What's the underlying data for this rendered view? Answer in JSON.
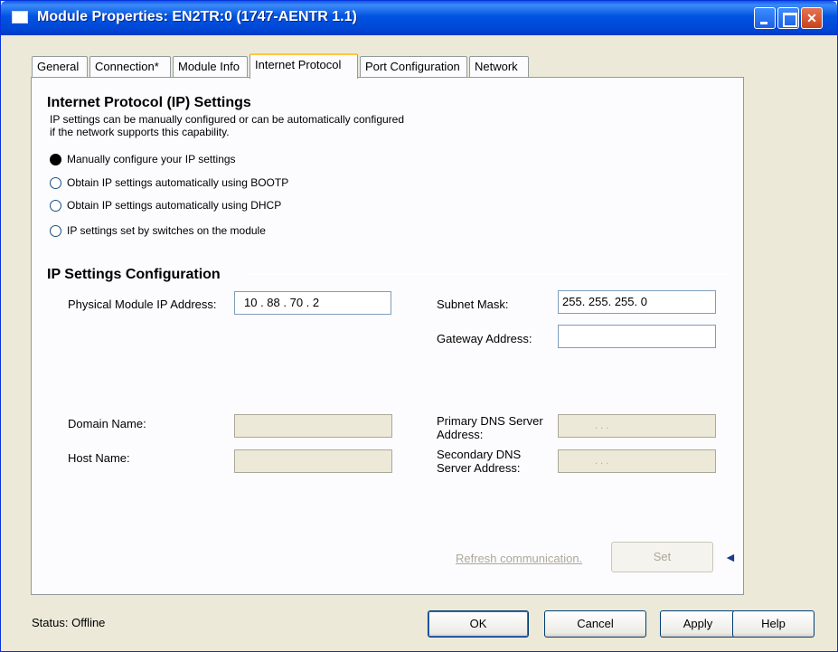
{
  "window": {
    "title": "Module Properties: EN2TR:0 (1747-AENTR 1.1)"
  },
  "tabs": [
    {
      "label": "General"
    },
    {
      "label": "Connection*"
    },
    {
      "label": "Module Info"
    },
    {
      "label": "Internet Protocol",
      "active": true
    },
    {
      "label": "Port Configuration"
    },
    {
      "label": "Network"
    }
  ],
  "ip_settings": {
    "heading": "Internet Protocol (IP) Settings",
    "description_line1": "IP settings can be manually configured or can be automatically configured",
    "description_line2": "if the network supports this capability.",
    "options": [
      {
        "label": "Manually configure your IP settings",
        "selected": true
      },
      {
        "label": "Obtain IP settings automatically using BOOTP",
        "selected": false
      },
      {
        "label": "Obtain IP settings automatically using DHCP",
        "selected": false
      },
      {
        "label": "IP settings set by switches on the module",
        "selected": false
      }
    ]
  },
  "config": {
    "heading": "IP Settings Configuration",
    "ip_label": "Physical Module IP Address:",
    "ip_value": "10 .  88  .  70  .  2",
    "subnet_label": "Subnet Mask:",
    "subnet_value": "255. 255. 255. 0",
    "gateway_label": "Gateway Address:",
    "gateway_value": "",
    "domain_label": "Domain Name:",
    "domain_value": "",
    "host_label": "Host Name:",
    "host_value": "",
    "primary_dns_label": "Primary DNS Server Address:",
    "primary_dns_value": ".        .        .",
    "secondary_dns_label": "Secondary DNS Server Address:",
    "secondary_dns_value": ".        .        .",
    "refresh_label": "Refresh communication.",
    "set_label": "Set"
  },
  "footer": {
    "status": "Status:  Offline",
    "ok_label": "OK",
    "cancel_label": "Cancel",
    "apply_label": "Apply",
    "help_label": "Help"
  }
}
